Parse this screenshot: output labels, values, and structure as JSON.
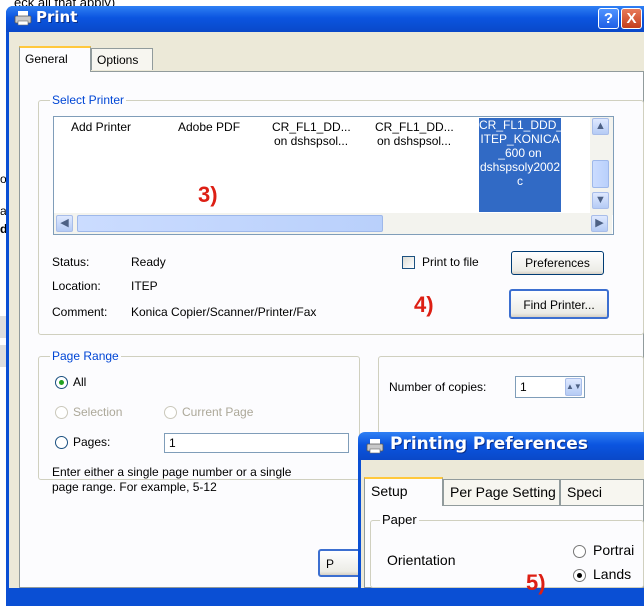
{
  "background_app": {
    "top_text": "eck all that apply)",
    "side_letters": [
      "o",
      "a",
      "d"
    ]
  },
  "print_dialog": {
    "title": "Print",
    "help_button": "?",
    "close_button": "X",
    "tabs": [
      "General",
      "Options"
    ],
    "select_printer": {
      "legend": "Select Printer",
      "printers": [
        {
          "line1": "Add Printer",
          "line2": ""
        },
        {
          "line1": "Adobe PDF",
          "line2": ""
        },
        {
          "line1": "CR_FL1_DD...",
          "line2": "on dshspsol..."
        },
        {
          "line1": "CR_FL1_DD...",
          "line2": "on dshspsol..."
        }
      ],
      "selected_printer": {
        "lines": [
          "CR_FL1_DDD_",
          "ITEP_KONICA",
          "_600 on",
          "dshspsoly2002",
          "c"
        ]
      },
      "status_label": "Status:",
      "status_value": "Ready",
      "location_label": "Location:",
      "location_value": "ITEP",
      "comment_label": "Comment:",
      "comment_value": "Konica Copier/Scanner/Printer/Fax",
      "print_to_file_label": "Print to file",
      "print_to_file_checked": false,
      "preferences_button": "Preferences",
      "find_printer_button": "Find Printer..."
    },
    "page_range": {
      "legend": "Page Range",
      "all_label": "All",
      "selection_label": "Selection",
      "current_page_label": "Current Page",
      "pages_label": "Pages:",
      "pages_value": "1",
      "help_text_line1": "Enter either a single page number or a single",
      "help_text_line2": "page range.  For example, 5-12",
      "selected": "All"
    },
    "copies": {
      "label": "Number of copies:",
      "value": "1"
    },
    "partial_button_letter": "P"
  },
  "annotations": {
    "step3": "3)",
    "step4": "4)",
    "step5": "5)"
  },
  "printing_preferences": {
    "title": "Printing Preferences",
    "tabs": [
      "Setup",
      "Per Page Setting",
      "Speci"
    ],
    "paper_legend": "Paper",
    "orientation_label": "Orientation",
    "portrait_label": "Portrai",
    "landscape_label": "Lands",
    "orientation_selected": "Landscape"
  },
  "colors": {
    "title_blue": "#0b55e0",
    "selection_blue": "#316ac5",
    "annotation_red": "#dd1f14",
    "legend_blue": "#0046d5"
  }
}
